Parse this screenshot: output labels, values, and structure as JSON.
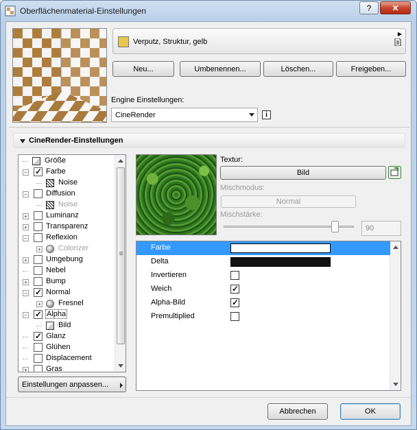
{
  "window": {
    "title": "Oberflächenmaterial-Einstellungen",
    "help_label": "?",
    "close_label": "✕"
  },
  "material": {
    "name": "Verputz, Struktur, gelb",
    "swatch_color": "#e9c64a"
  },
  "actions": {
    "new": "Neu...",
    "rename": "Umbenennen...",
    "delete": "Löschen...",
    "share": "Freigeben..."
  },
  "engine": {
    "label": "Engine Einstellungen:",
    "value": "CineRender"
  },
  "section": {
    "title": "CineRender-Einstellungen"
  },
  "tree": {
    "items": [
      {
        "label": "Größe",
        "level": 0,
        "expander": "none",
        "checkbox": "none",
        "icon": "size-icon",
        "dim": false
      },
      {
        "label": "Farbe",
        "level": 0,
        "expander": "minus",
        "checkbox": "checked",
        "icon": "",
        "dim": false
      },
      {
        "label": "Noise",
        "level": 1,
        "expander": "none",
        "checkbox": "none",
        "icon": "noise-icon",
        "dim": false
      },
      {
        "label": "Diffusion",
        "level": 0,
        "expander": "minus",
        "checkbox": "unchecked",
        "icon": "",
        "dim": false
      },
      {
        "label": "Noise",
        "level": 1,
        "expander": "none",
        "checkbox": "none",
        "icon": "noise-icon",
        "dim": true
      },
      {
        "label": "Luminanz",
        "level": 0,
        "expander": "plus",
        "checkbox": "unchecked",
        "icon": "",
        "dim": false
      },
      {
        "label": "Transparenz",
        "level": 0,
        "expander": "plus",
        "checkbox": "unchecked",
        "icon": "",
        "dim": false
      },
      {
        "label": "Reflexion",
        "level": 0,
        "expander": "minus",
        "checkbox": "unchecked",
        "icon": "",
        "dim": false
      },
      {
        "label": "Colorizer",
        "level": 1,
        "expander": "plus",
        "checkbox": "none",
        "icon": "sphere-icon",
        "dim": true
      },
      {
        "label": "Umgebung",
        "level": 0,
        "expander": "plus",
        "checkbox": "unchecked",
        "icon": "",
        "dim": false
      },
      {
        "label": "Nebel",
        "level": 0,
        "expander": "none",
        "checkbox": "unchecked",
        "icon": "",
        "dim": false
      },
      {
        "label": "Bump",
        "level": 0,
        "expander": "plus",
        "checkbox": "unchecked",
        "icon": "",
        "dim": false
      },
      {
        "label": "Normal",
        "level": 0,
        "expander": "minus",
        "checkbox": "checked",
        "icon": "",
        "dim": false
      },
      {
        "label": "Fresnel",
        "level": 1,
        "expander": "plus",
        "checkbox": "none",
        "icon": "sphere-icon",
        "dim": false
      },
      {
        "label": "Alpha",
        "level": 0,
        "expander": "minus",
        "checkbox": "checked",
        "icon": "",
        "dim": false,
        "selected": true
      },
      {
        "label": "Bild",
        "level": 1,
        "expander": "none",
        "checkbox": "none",
        "icon": "image-icon",
        "dim": false
      },
      {
        "label": "Glanz",
        "level": 0,
        "expander": "none",
        "checkbox": "checked",
        "icon": "",
        "dim": false
      },
      {
        "label": "Glühen",
        "level": 0,
        "expander": "none",
        "checkbox": "unchecked",
        "icon": "",
        "dim": false
      },
      {
        "label": "Displacement",
        "level": 0,
        "expander": "none",
        "checkbox": "unchecked",
        "icon": "",
        "dim": false
      },
      {
        "label": "Gras",
        "level": 0,
        "expander": "plus",
        "checkbox": "unchecked",
        "icon": "",
        "dim": false
      }
    ],
    "customize_label": "Einstellungen anpassen..."
  },
  "texture": {
    "label": "Textur:",
    "button": "Bild",
    "blend_mode_label": "Mischmodus:",
    "blend_mode_value": "Normal",
    "blend_strength_label": "Mischstärke:",
    "blend_strength_value": "90"
  },
  "properties": [
    {
      "name": "Farbe",
      "type": "color",
      "color": "#ffffff",
      "selected": true
    },
    {
      "name": "Delta",
      "type": "color",
      "color": "#111111",
      "selected": false
    },
    {
      "name": "Invertieren",
      "type": "checkbox",
      "checked": false,
      "selected": false
    },
    {
      "name": "Weich",
      "type": "checkbox",
      "checked": true,
      "selected": false
    },
    {
      "name": "Alpha-Bild",
      "type": "checkbox",
      "checked": true,
      "selected": false
    },
    {
      "name": "Premultiplied",
      "type": "checkbox",
      "checked": false,
      "selected": false
    }
  ],
  "footer": {
    "cancel": "Abbrechen",
    "ok": "OK"
  }
}
